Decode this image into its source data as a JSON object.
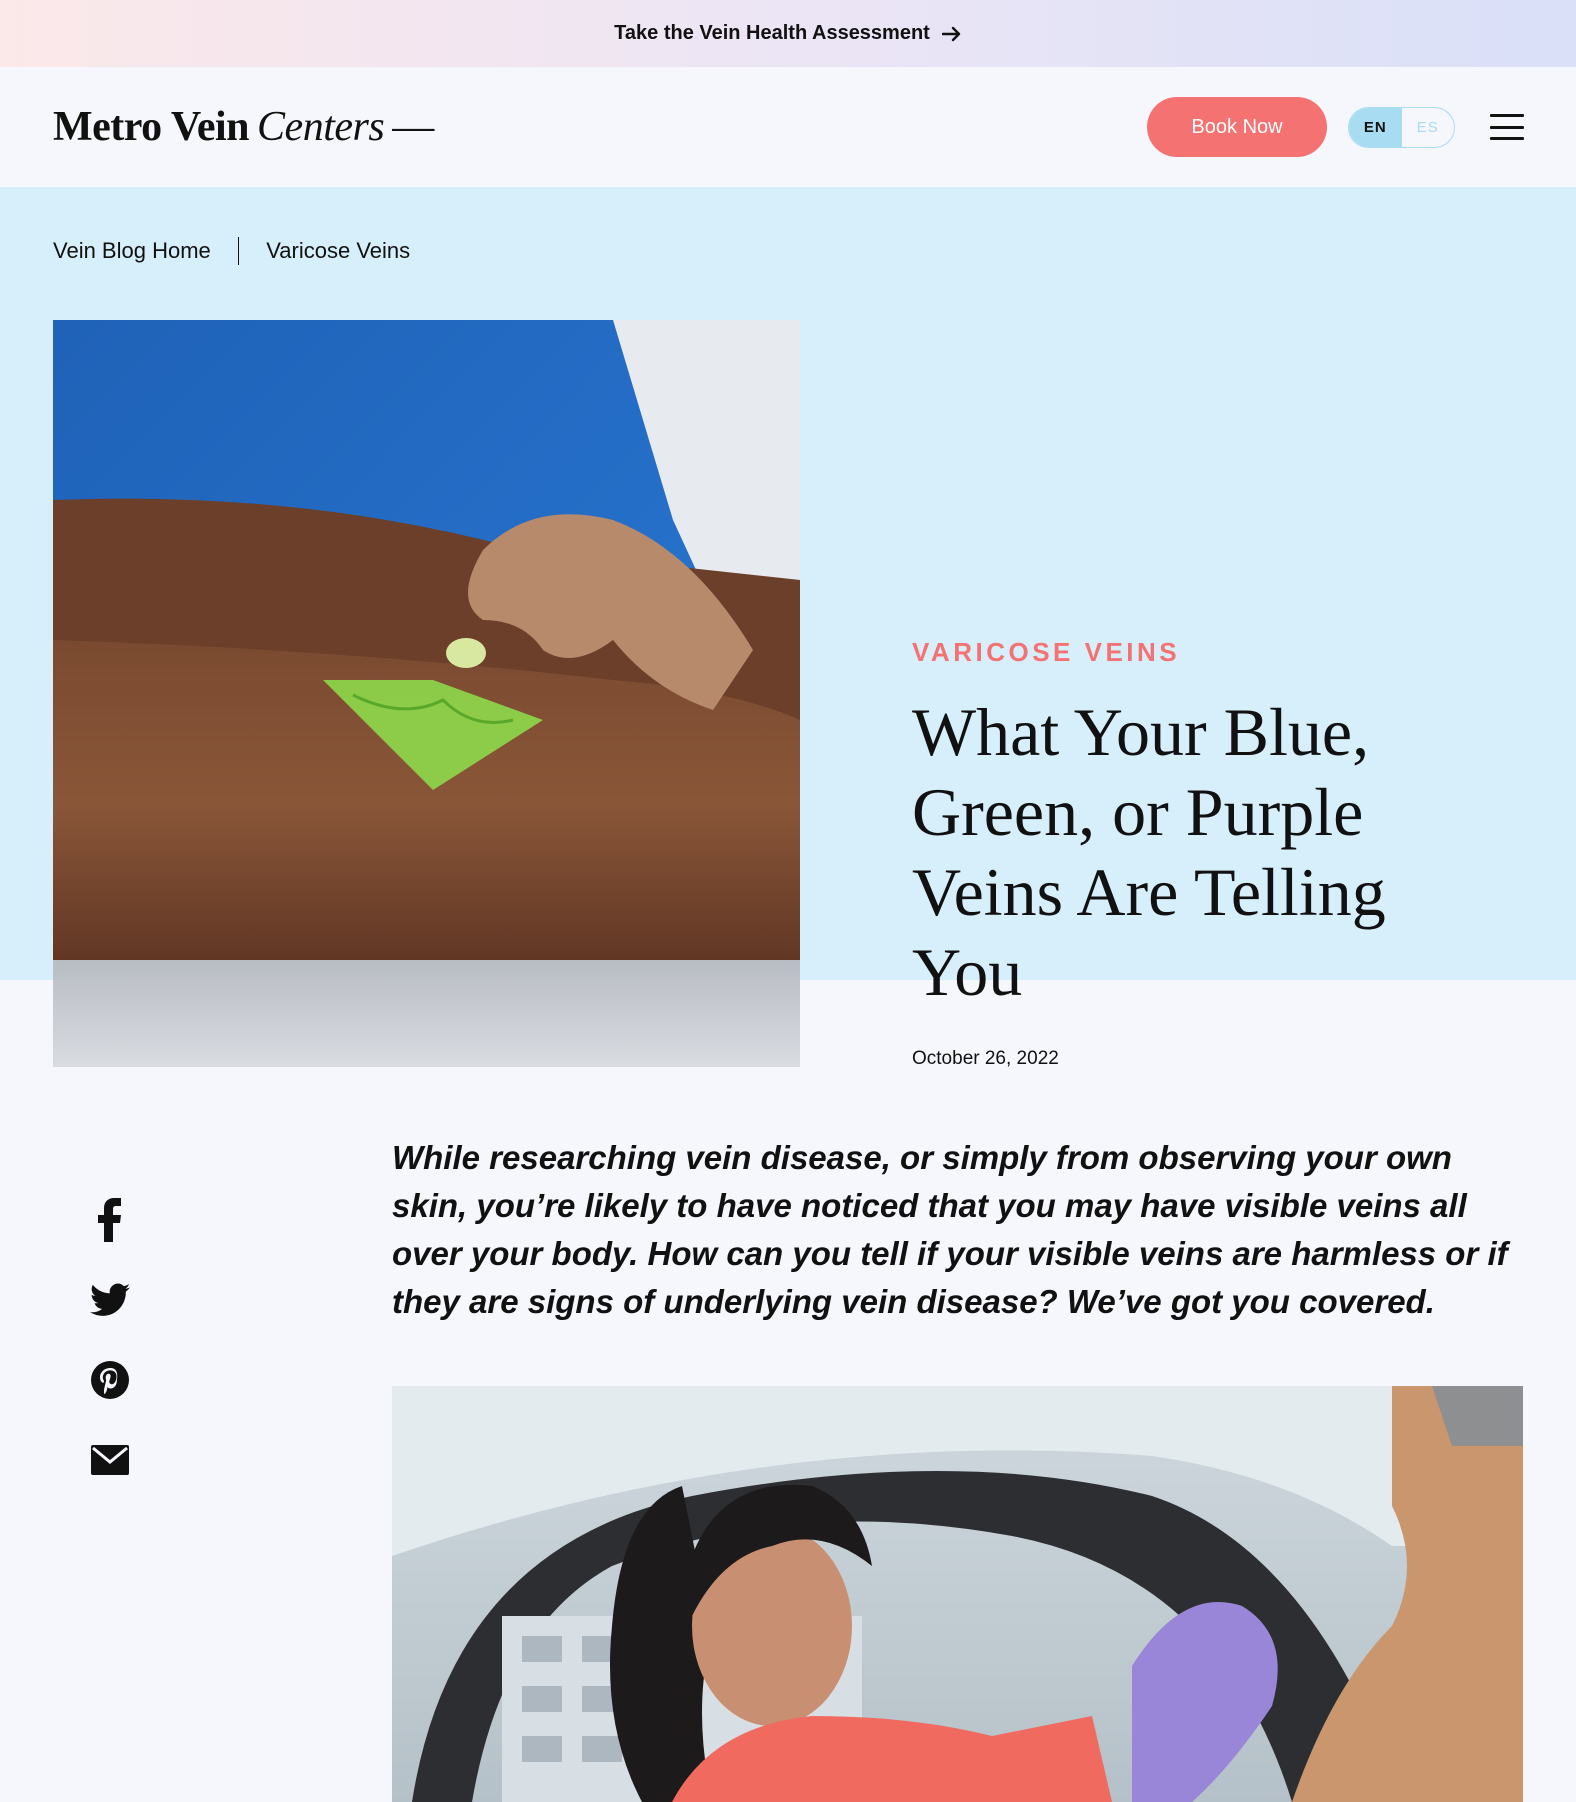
{
  "promo": {
    "text": "Take the Vein Health Assessment",
    "arrow_icon": "arrow-right-icon"
  },
  "header": {
    "logo_main": "Metro Vein",
    "logo_italic": "Centers",
    "logo_dash": "—",
    "book_button": "Book Now",
    "lang_en": "EN",
    "lang_es": "ES",
    "menu_icon": "hamburger-menu-icon"
  },
  "breadcrumb": {
    "items": [
      "Vein Blog Home",
      "Varicose Veins"
    ]
  },
  "article": {
    "category": "VARICOSE VEINS",
    "title": "What Your Blue, Green, or Purple Veins Are Telling You",
    "date": "October 26, 2022",
    "intro": "While researching vein disease, or simply from observing your own skin, you’re likely to have noticed that you may have visible veins all over your body. How can you tell if your visible veins are harmless or if they are signs of underlying vein disease? We’ve got you covered."
  },
  "social": [
    "facebook-icon",
    "twitter-icon",
    "pinterest-icon",
    "email-icon"
  ],
  "colors": {
    "accent": "#f47272",
    "hero_bg": "#d6effb",
    "page_bg": "#f5f7fd",
    "lang_active": "#a8dcf3"
  }
}
